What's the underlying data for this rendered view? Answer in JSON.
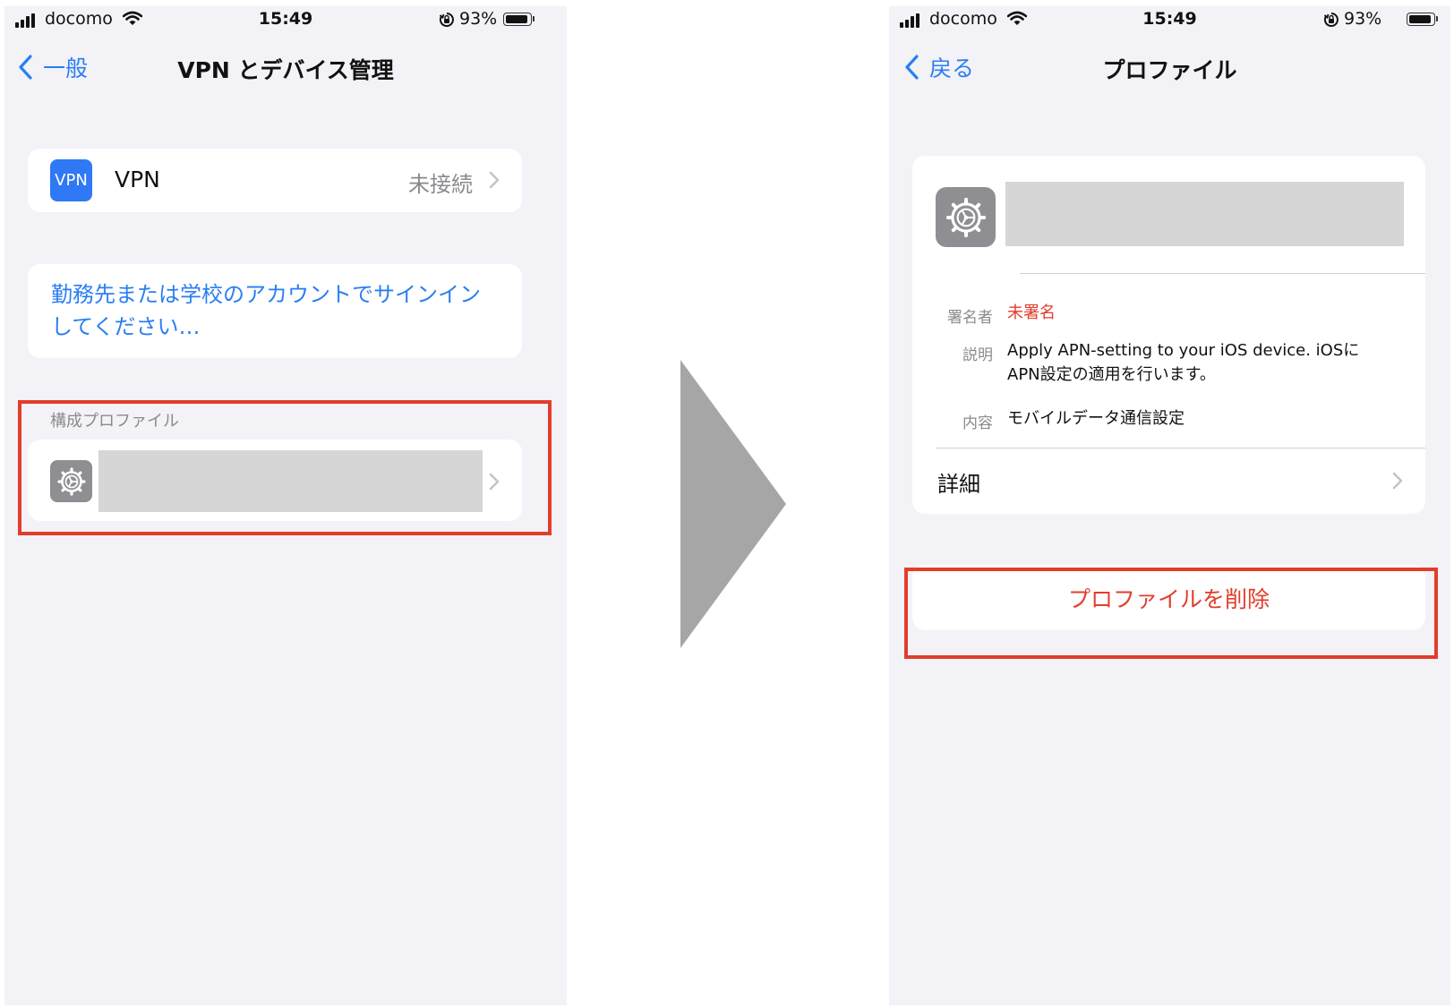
{
  "status_bar": {
    "carrier": "docomo",
    "time": "15:49",
    "battery": "93%",
    "battery_level": 0.93
  },
  "left_screen": {
    "back_label": "一般",
    "title": "VPN とデバイス管理",
    "vpn_row": {
      "icon_text": "VPN",
      "label": "VPN",
      "status": "未接続"
    },
    "signin_link": "勤務先または学校のアカウントでサインインしてください…",
    "profiles_section_header": "構成プロファイル"
  },
  "right_screen": {
    "back_label": "戻る",
    "title": "プロファイル",
    "details": [
      {
        "label": "署名者",
        "value": "未署名",
        "value_color": "#e23d2b"
      },
      {
        "label": "説明",
        "value": "Apply APN-setting to your iOS device. iOSにAPN設定の適用を行います。"
      },
      {
        "label": "内容",
        "value": "モバイルデータ通信設定"
      }
    ],
    "more_details_label": "詳細",
    "delete_button_label": "プロファイルを削除"
  },
  "colors": {
    "accent": "#2a7ef3",
    "destructive": "#e23d2b",
    "highlight": "#e23d2b",
    "arrow": "#a6a6a6",
    "background": "#f2f2f7"
  }
}
